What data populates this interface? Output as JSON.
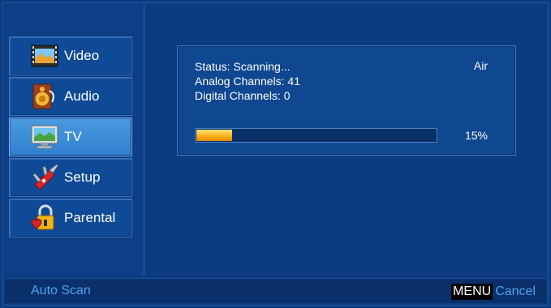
{
  "sidebar": {
    "items": [
      {
        "label": "Video",
        "icon": "video-film-icon",
        "selected": false
      },
      {
        "label": "Audio",
        "icon": "audio-speaker-icon",
        "selected": false
      },
      {
        "label": "TV",
        "icon": "tv-monitor-icon",
        "selected": true
      },
      {
        "label": "Setup",
        "icon": "swiss-knife-icon",
        "selected": false
      },
      {
        "label": "Parental",
        "icon": "padlock-heart-icon",
        "selected": false
      }
    ]
  },
  "scan": {
    "status": "Status: Scanning...",
    "analog": "Analog Channels: 41",
    "digital": "Digital Channels: 0",
    "source": "Air",
    "progress_label": "15%",
    "progress_fraction": 0.15
  },
  "footer": {
    "title": "Auto Scan",
    "key_label": "MENU",
    "action_label": "Cancel"
  },
  "colors": {
    "background": "#0d3b80",
    "selected_item": "#3a8ad6",
    "accent_text": "#4da6ee",
    "progress_fill": "#f7b21b"
  }
}
